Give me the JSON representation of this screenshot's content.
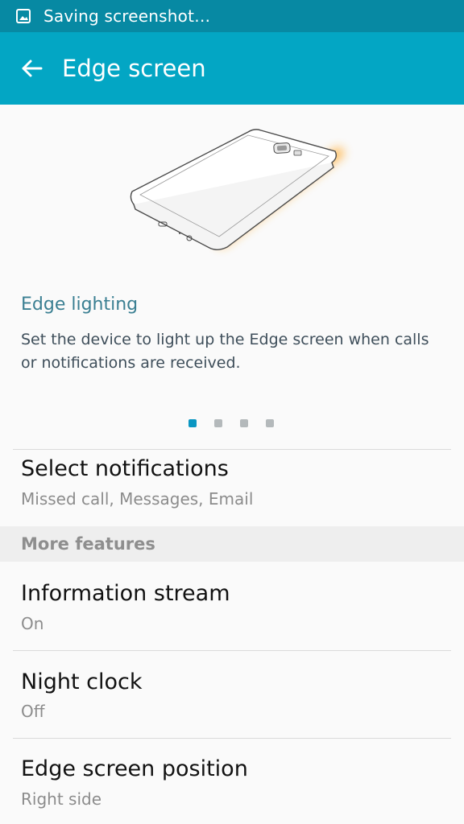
{
  "status_bar": {
    "text": "Saving screenshot…",
    "icon": "image-icon"
  },
  "app_bar": {
    "title": "Edge screen",
    "back_icon": "back-arrow-icon"
  },
  "card": {
    "title": "Edge lighting",
    "description": "Set the device to light up the Edge screen when calls or notifications are received.",
    "page_count": 4,
    "active_page": 1
  },
  "settings": {
    "select_notifications": {
      "title": "Select notifications",
      "summary": "Missed call, Messages, Email"
    },
    "section_header": "More features",
    "information_stream": {
      "title": "Information stream",
      "summary": "On"
    },
    "night_clock": {
      "title": "Night clock",
      "summary": "Off"
    },
    "edge_screen_position": {
      "title": "Edge screen position",
      "summary": "Right side"
    }
  },
  "colors": {
    "status_bar": "#0789a3",
    "app_bar": "#03a6c4",
    "accent_title": "#3a7f92",
    "active_dot": "#0a96c2",
    "edge_glow": "#ffa726"
  }
}
